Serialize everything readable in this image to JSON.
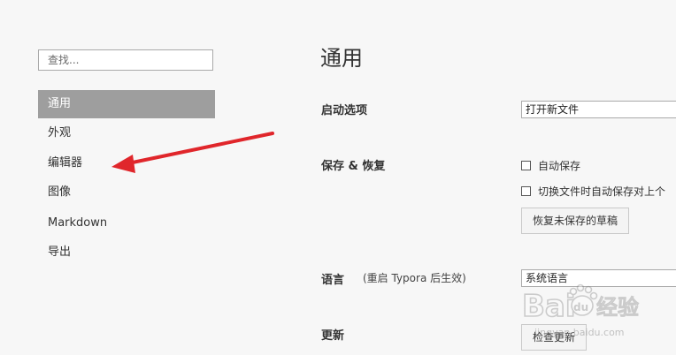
{
  "sidebar": {
    "search_placeholder": "查找...",
    "items": [
      {
        "label": "通用"
      },
      {
        "label": "外观"
      },
      {
        "label": "编辑器"
      },
      {
        "label": "图像"
      },
      {
        "label": "Markdown"
      },
      {
        "label": "导出"
      }
    ],
    "active_index": 0
  },
  "main": {
    "title": "通用",
    "startup": {
      "label": "启动选项",
      "selected": "打开新文件"
    },
    "save_restore": {
      "label": "保存 & 恢复",
      "autosave_label": "自动保存",
      "autosave_checked": false,
      "switch_save_label": "切换文件时自动保存对上个",
      "switch_save_checked": false,
      "recover_button": "恢复未保存的草稿"
    },
    "language": {
      "label": "语言",
      "note": "(重启 Typora 后生效)",
      "selected": "系统语言"
    },
    "update": {
      "label": "更新",
      "check_button": "检查更新"
    }
  },
  "watermark": {
    "text_latin": "Bai",
    "text_paw": "du",
    "text_cn": "经验",
    "url": "jingyan.baidu.com"
  },
  "colors": {
    "active_nav_bg": "#9e9e9e",
    "arrow": "#e0262b",
    "background": "#f7f7f7"
  }
}
